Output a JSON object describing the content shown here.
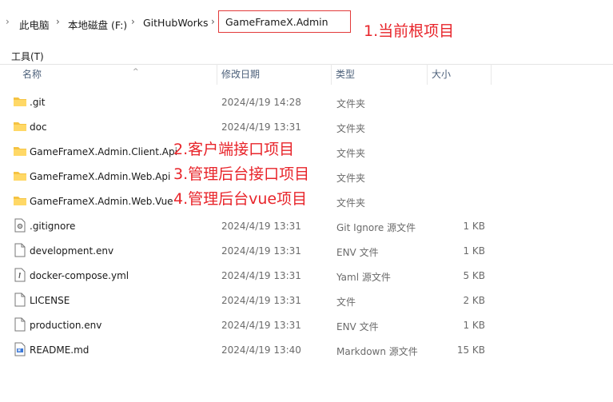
{
  "breadcrumb": {
    "items": [
      "此电脑",
      "本地磁盘 (F:)",
      "GitHubWorks"
    ],
    "current": "GameFrameX.Admin"
  },
  "annotations": {
    "root": "1.当前根项目",
    "client_api": "2.客户端接口项目",
    "web_api": "3.管理后台接口项目",
    "web_vue": "4.管理后台vue项目"
  },
  "toolbar": {
    "label": "工具(T)"
  },
  "columns": {
    "name": "名称",
    "date": "修改日期",
    "type": "类型",
    "size": "大小"
  },
  "files": [
    {
      "name": ".git",
      "date": "2024/4/19 14:28",
      "type": "文件夹",
      "size": "",
      "icon": "folder-icon"
    },
    {
      "name": "doc",
      "date": "2024/4/19 13:31",
      "type": "文件夹",
      "size": "",
      "icon": "folder-icon"
    },
    {
      "name": "GameFrameX.Admin.Client.Api",
      "date": "",
      "type": "文件夹",
      "size": "",
      "icon": "folder-icon"
    },
    {
      "name": "GameFrameX.Admin.Web.Api",
      "date": "",
      "type": "文件夹",
      "size": "",
      "icon": "folder-icon"
    },
    {
      "name": "GameFrameX.Admin.Web.Vue",
      "date": "",
      "type": "文件夹",
      "size": "",
      "icon": "folder-icon"
    },
    {
      "name": ".gitignore",
      "date": "2024/4/19 13:31",
      "type": "Git Ignore 源文件",
      "size": "1 KB",
      "icon": "settings-file-icon"
    },
    {
      "name": "development.env",
      "date": "2024/4/19 13:31",
      "type": "ENV 文件",
      "size": "1 KB",
      "icon": "file-icon"
    },
    {
      "name": "docker-compose.yml",
      "date": "2024/4/19 13:31",
      "type": "Yaml 源文件",
      "size": "5 KB",
      "icon": "script-file-icon"
    },
    {
      "name": "LICENSE",
      "date": "2024/4/19 13:31",
      "type": "文件",
      "size": "2 KB",
      "icon": "file-icon"
    },
    {
      "name": "production.env",
      "date": "2024/4/19 13:31",
      "type": "ENV 文件",
      "size": "1 KB",
      "icon": "file-icon"
    },
    {
      "name": "README.md",
      "date": "2024/4/19 13:40",
      "type": "Markdown 源文件",
      "size": "15 KB",
      "icon": "markdown-file-icon"
    }
  ],
  "colors": {
    "annotation": "#e8242a",
    "folder": "#f5c342",
    "header_text": "#4c607a"
  }
}
